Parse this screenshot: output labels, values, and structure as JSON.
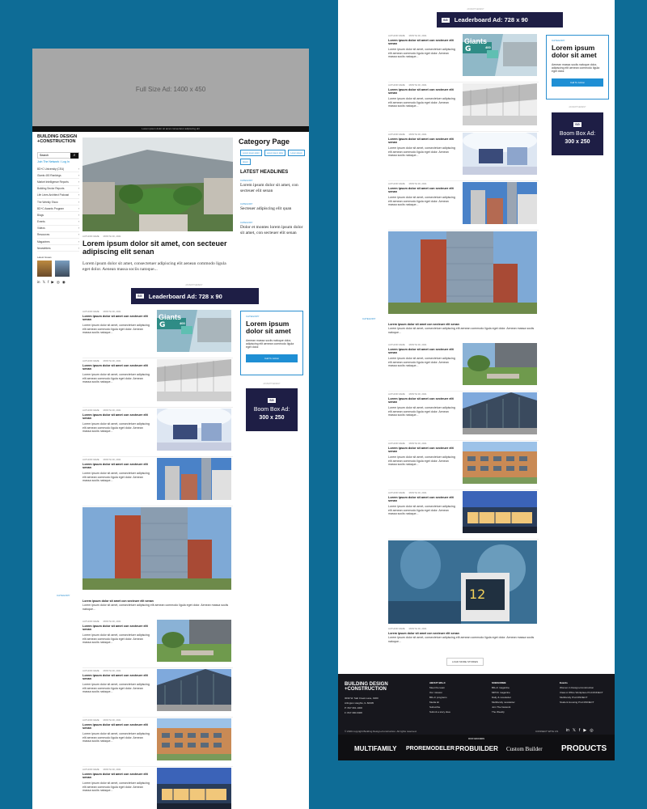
{
  "left_page": {
    "ad_full_label": "Full Size Ad: 1400 x 450",
    "topbar_text": "Lorem ipsum dolor sit amet consectetur adipiscing elit",
    "logo": {
      "line1": "BUILDING DESIGN",
      "line2": "+CONSTRUCTION"
    },
    "search_placeholder": "Search",
    "join_link": "Join The Network / Log In",
    "nav_items": [
      "BD+C University (CEU)",
      "Giants 400 Rankings",
      "Market Intelligence Reports",
      "Building Sector Reports",
      "Life Lines Architect Podcast",
      "The Weekly Show",
      "BD+C Awards Program",
      "Blogs",
      "Events",
      "Videos",
      "Resources",
      "Magazines",
      "Newsletters"
    ],
    "latest_issue_label": "Latest Issues",
    "category_title": "Category Page",
    "tags": [
      "Lorem ipsum dolor",
      "Lorem ipsum dolor",
      "Lorem ipsum",
      "Ipsum"
    ],
    "latest_headlines": "LATEST HEADLINES",
    "headlines": [
      {
        "cat": "CATEGORY",
        "title": "Lorem ipsum dolor sit amet, con secteuer elit senan"
      },
      {
        "cat": "CATEGORY",
        "title": "Secteuer adipiscing elit quan"
      },
      {
        "cat": "CATEGORY",
        "title": "Dolor et montes lorem ipsum dolor sit amet, con secteuer elit senan"
      }
    ],
    "hero": {
      "author": "AUTHOR NAME",
      "date": "MONTH 00, 2021",
      "title": "Lorem ipsum dolor sit amet, con secteuer adipiscing elit senan",
      "excerpt": "Lorem ipsum dolor sit amet, consectetuer adipiscing elit aenean commodo ligula eget dolor. Aenean massa sociis natoque..."
    },
    "leaderboard": {
      "brand": "SCRANTON GILLETTE",
      "label": "Leaderboard Ad: 728 x 90"
    },
    "ad_tiny": "ADVERTISEMENT"
  },
  "article": {
    "author": "AUTHOR NAME",
    "date": "MONTH 00, 2021",
    "title": "Lorem ipsum dolor sit amet con secteuer elit senan",
    "excerpt": "Lorem ipsum dolor sit amet, consectetuer adipiscing elit aenean commodo ligula eget dolor. Aenean massa sociis natoque..."
  },
  "feature": {
    "category": "CATEGORY",
    "title": "Lorem ipsum dolor sit amet con secteuer elit senan",
    "excerpt": "Lorem ipsum dolor sit amet, consectetuer adipiscing elit aenean commodo ligula eget dolor. Aenean massa sociis natoque..."
  },
  "promo": {
    "category": "CATEGORY",
    "title": "Lorem ipsum dolor sit amet",
    "body": "Aenean massa sociis natoque dolor, adipiscing elit aenean commodo ligula eget dolor.",
    "button": "Call To Action"
  },
  "boom": {
    "brand": "SCRANTON GILLETTE",
    "line1": "Boom Box Ad:",
    "line2": "300 x 250"
  },
  "giants_label": "Giants",
  "giants_num": "400",
  "load_more": "LOAD MORE STORIES",
  "footer": {
    "logo1": "BUILDING DESIGN",
    "logo2": "+CONSTRUCTION",
    "address": [
      "3030 W. Salt Creek Lane, #200",
      "Arlington Heights, IL 60005",
      "P: 847.391.1000",
      "F: 847.390.0408"
    ],
    "col_about": {
      "title": "ABOUT BD+C",
      "items": [
        "Meet the team",
        "Our mission",
        "BD+C programs",
        "Media kit",
        "Subscribe",
        "Submit a story idea"
      ]
    },
    "col_subscribe": {
      "title": "SUBSCRIBE",
      "items": [
        "BD+C magazine",
        "MPOC magazine",
        "Daily & newsletter",
        "Multifamily newsletter",
        "Join The Network",
        "The Weekly"
      ]
    },
    "col_events": {
      "title": "Events",
      "items": [
        "Women in Design+Construction",
        "Class A Office Workplace PinCONNECT",
        "Multifamily ProCONNECT",
        "Student Housing ProCONNECT"
      ]
    },
    "copyright": "© 2020 copyright Building Design+Construction. All rights reserved.",
    "connect": "CONNECT WITH US",
    "our_brands": "OUR BRANDS",
    "brands": [
      "MULTIFAMILY",
      "PROREMODELER",
      "PROBUILDER",
      "Custom Builder",
      "PRODUCTS"
    ]
  }
}
